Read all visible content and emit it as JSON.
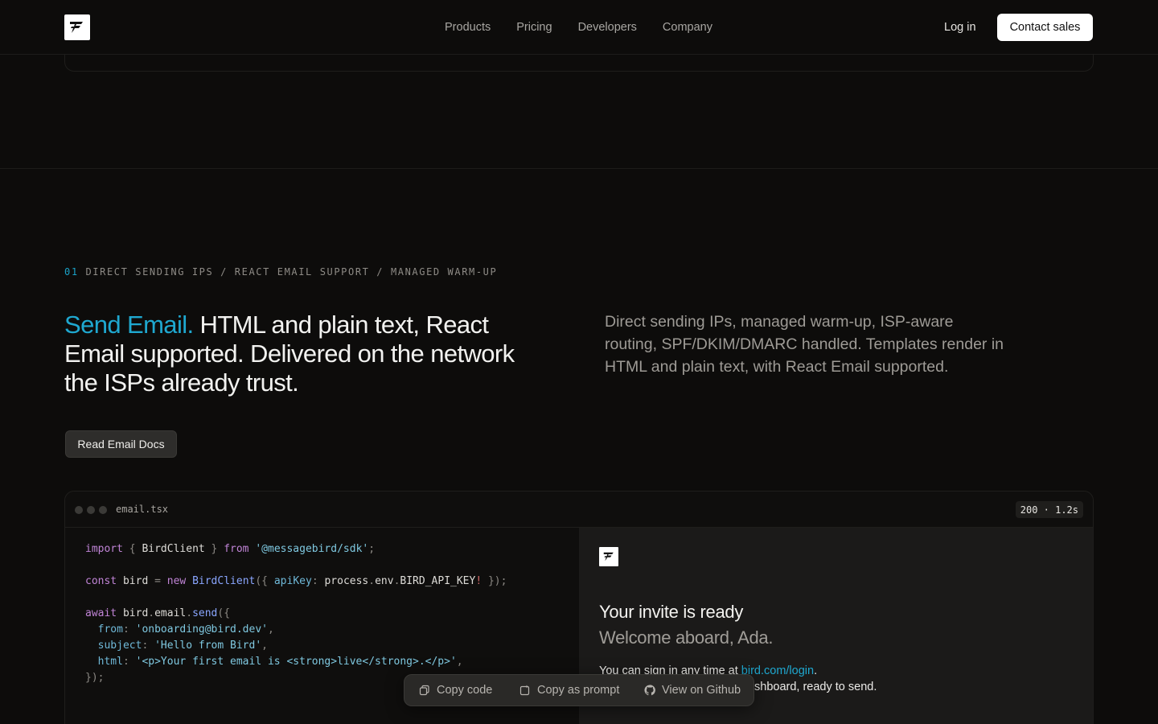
{
  "nav": {
    "links": [
      "Products",
      "Pricing",
      "Developers",
      "Company"
    ],
    "login": "Log in",
    "cta": "Contact sales"
  },
  "section": {
    "eyebrow_num": "01",
    "eyebrow_text": "DIRECT SENDING IPS / REACT EMAIL SUPPORT / MANAGED WARM-UP",
    "headline_accent": "Send Email.",
    "headline_rest": " HTML and plain text, React Email supported. Delivered on the network the ISPs already trust.",
    "description": "Direct sending IPs, managed warm-up, ISP-aware routing, SPF/DKIM/DMARC handled. Templates render in HTML and plain text, with React Email supported.",
    "docs_button": "Read Email Docs"
  },
  "code_card": {
    "filename": "email.tsx",
    "status": "200 · 1.2s"
  },
  "preview": {
    "title": "Your invite is ready",
    "subtitle": "Welcome aboard, Ada.",
    "line1_pre": "You can sign in any time at ",
    "line1_link": "bird.com/login",
    "line1_post": ".",
    "line2": "shboard, ready to send."
  },
  "toolbar": {
    "copy_code": "Copy code",
    "copy_prompt": "Copy as prompt",
    "github": "View on Github"
  }
}
